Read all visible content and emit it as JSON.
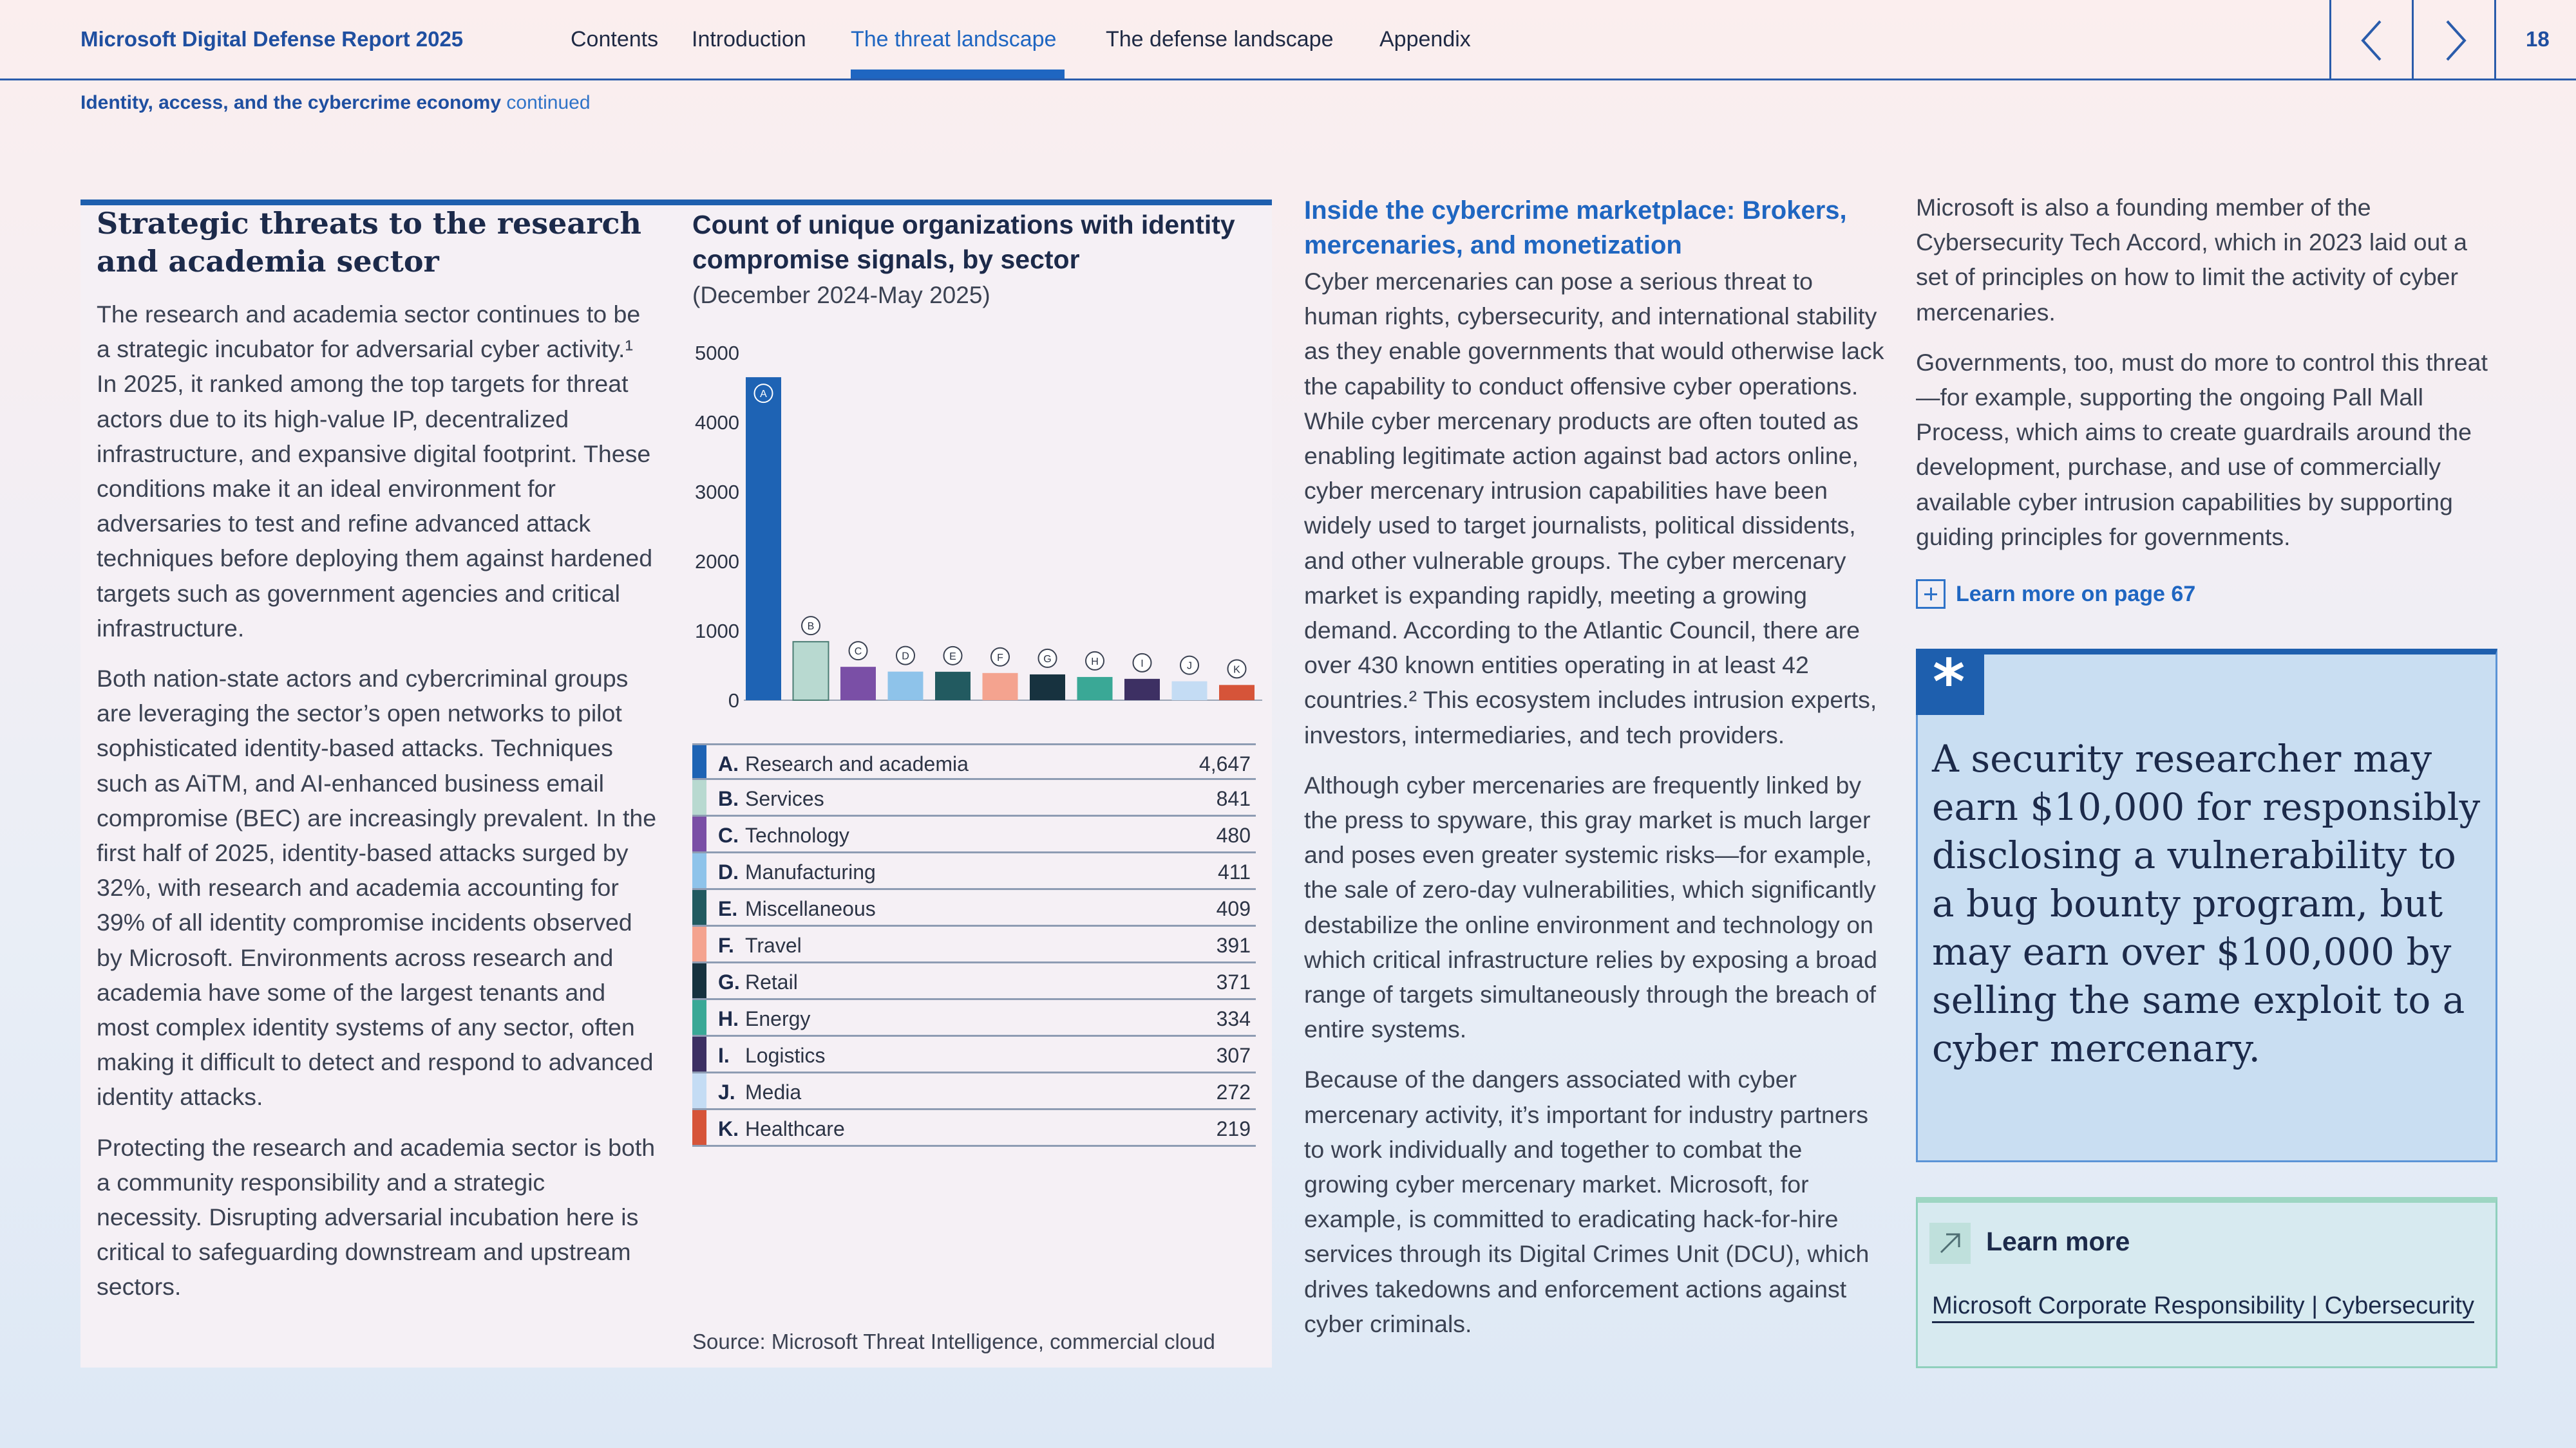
{
  "header": {
    "brand": "Microsoft Digital Defense Report 2025",
    "nav": [
      "Contents",
      "Introduction",
      "The threat landscape",
      "The defense landscape",
      "Appendix"
    ],
    "active_nav": "The threat landscape",
    "page_number": "18",
    "accent_color": "#1f66c1"
  },
  "breadcrumb": {
    "section": "Identity, access, and the cybercrime economy",
    "suffix": "continued"
  },
  "left": {
    "heading": "Strategic threats to the research and academia sector",
    "paragraphs": [
      "The research and academia sector continues to be a strategic incubator for adversarial cyber activity.¹ In 2025, it ranked among the top targets for threat actors due to its high-value IP, decentralized infrastructure, and expansive digital footprint. These conditions make it an ideal environment for adversaries to test and refine advanced attack techniques before deploying them against hardened targets such as government agencies and critical infrastructure.",
      "Both nation-state actors and cybercriminal groups are leveraging the sector’s open networks to pilot sophisticated identity-based attacks. Techniques such as AiTM, and AI-enhanced business email compromise (BEC) are increasingly prevalent. In the first half of 2025, identity-based attacks surged by 32%, with research and academia accounting for 39% of all identity compromise incidents observed by Microsoft. Environments across research and academia have some of the largest tenants and most complex identity systems of any sector, often making it difficult to detect and respond to advanced identity attacks.",
      "Protecting the research and academia sector is both a community responsibility and a strategic necessity. Disrupting adversarial incubation here is critical to safeguarding downstream and upstream sectors."
    ]
  },
  "chart_data": {
    "type": "bar",
    "title": "Count of unique organizations with identity compromise signals, by sector",
    "subtitle": "(December 2024-May 2025)",
    "categories": [
      "A",
      "B",
      "C",
      "D",
      "E",
      "F",
      "G",
      "H",
      "I",
      "J",
      "K"
    ],
    "labels": [
      "Research and academia",
      "Services",
      "Technology",
      "Manufacturing",
      "Miscellaneous",
      "Travel",
      "Retail",
      "Energy",
      "Logistics",
      "Media",
      "Healthcare"
    ],
    "values": [
      4647,
      841,
      480,
      411,
      409,
      391,
      371,
      334,
      307,
      272,
      219
    ],
    "value_labels": [
      "4,647",
      "841",
      "480",
      "411",
      "409",
      "391",
      "371",
      "334",
      "307",
      "272",
      "219"
    ],
    "colors": [
      "#1e63b4",
      "#b8d9d0",
      "#7a4fa6",
      "#8ec3ea",
      "#225a60",
      "#f4a38f",
      "#17323f",
      "#3aa896",
      "#3d3063",
      "#c4dcf4",
      "#d65439"
    ],
    "ylim": [
      0,
      5000
    ],
    "yticks": [
      0,
      1000,
      2000,
      3000,
      4000,
      5000
    ],
    "source": "Source: Microsoft Threat Intelligence, commercial cloud"
  },
  "legend_rows": [
    {
      "letter": "A.",
      "name": "Research and academia",
      "value": "4,647"
    },
    {
      "letter": "B.",
      "name": "Services",
      "value": "841"
    },
    {
      "letter": "C.",
      "name": "Technology",
      "value": "480"
    },
    {
      "letter": "D.",
      "name": "Manufacturing",
      "value": "411"
    },
    {
      "letter": "E.",
      "name": "Miscellaneous",
      "value": "409"
    },
    {
      "letter": "F.",
      "name": "Travel",
      "value": "391"
    },
    {
      "letter": "G.",
      "name": "Retail",
      "value": "371"
    },
    {
      "letter": "H.",
      "name": "Energy",
      "value": "334"
    },
    {
      "letter": "I.",
      "name": "Logistics",
      "value": "307"
    },
    {
      "letter": "J.",
      "name": "Media",
      "value": "272"
    },
    {
      "letter": "K.",
      "name": "Healthcare",
      "value": "219"
    }
  ],
  "middle": {
    "heading": "Inside the cybercrime marketplace: Brokers, mercenaries, and monetization",
    "paragraphs": [
      "Cyber mercenaries can pose a serious threat to human rights, cybersecurity, and international stability as they enable governments that would otherwise lack the capability to conduct offensive cyber operations. While cyber mercenary products are often touted as enabling legitimate action against bad actors online, cyber mercenary intrusion capabilities have been widely used to target journalists, political dissidents, and other vulnerable groups. The cyber mercenary market is expanding rapidly, meeting a growing demand. According to the Atlantic Council, there are over 430 known entities operating in at least 42 countries.² This ecosystem includes intrusion experts, investors, intermediaries, and tech providers.",
      "Although cyber mercenaries are frequently linked by the press to spyware, this gray market is much larger and poses even greater systemic risks—for example, the sale of zero-day vulnerabilities, which significantly destabilize the online environment and technology on which critical infrastructure relies by exposing a broad range of targets simultaneously through the breach of entire systems.",
      "Because of the dangers associated with cyber mercenary activity, it’s important for industry partners to work individually and together to combat the growing cyber mercenary market. Microsoft, for example, is committed to eradicating hack-for-hire services through its Digital Crimes Unit (DCU), which drives takedowns and enforcement actions against cyber criminals."
    ]
  },
  "right": {
    "paragraphs": [
      "Microsoft is also a founding member of the Cybersecurity Tech Accord, which in 2023 laid out a set of principles on how to limit the activity of cyber mercenaries.",
      "Governments, too, must do more to control this threat—for example, supporting the ongoing Pall Mall Process, which aims to create guardrails around the development, purchase, and use of commercially available cyber intrusion capabilities by supporting guiding principles for governments."
    ],
    "learn_page_label": "Learn more on page 67",
    "quote": "A security researcher may earn $10,000 for responsibly disclosing a vulnerability to a bug bounty program, but may earn over $100,000 by selling the same exploit to a cyber mercenary.",
    "learn_more_title": "Learn more",
    "learn_more_link": "Microsoft Corporate Responsibility | Cybersecurity"
  }
}
